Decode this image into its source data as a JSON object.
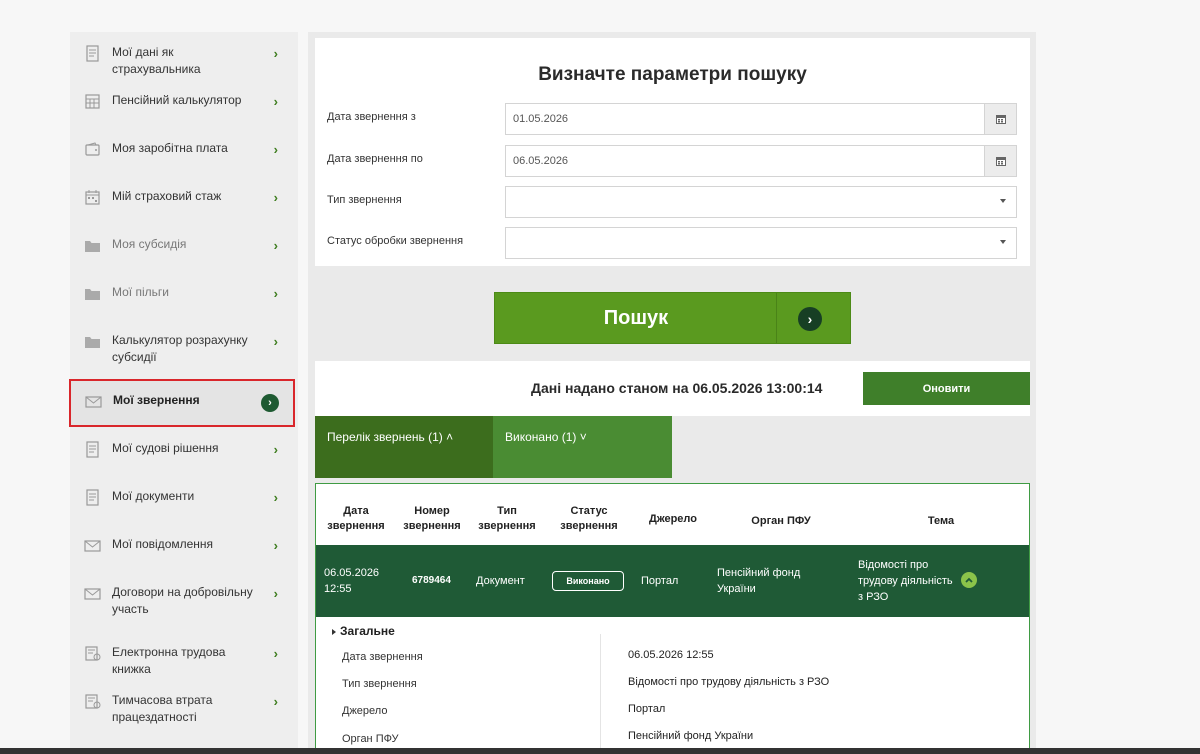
{
  "sidebar": {
    "items": [
      {
        "label": "Мої дані як страхувальника",
        "icon": "document-icon",
        "muted": false
      },
      {
        "label": "Пенсійний калькулятор",
        "icon": "calculator-icon",
        "muted": false
      },
      {
        "label": "Моя заробітна плата",
        "icon": "wallet-icon",
        "muted": false
      },
      {
        "label": "Мій страховий стаж",
        "icon": "calendar-icon",
        "muted": false
      },
      {
        "label": "Моя субсидія",
        "icon": "folder-icon",
        "muted": true
      },
      {
        "label": "Мої пільги",
        "icon": "folder-icon",
        "muted": true
      },
      {
        "label": "Калькулятор розрахунку субсидії",
        "icon": "folder-icon",
        "muted": false
      },
      {
        "label": "Мої звернення",
        "icon": "envelope-icon",
        "muted": false,
        "active": true
      },
      {
        "label": "Мої судові рішення",
        "icon": "document-icon",
        "muted": false
      },
      {
        "label": "Мої документи",
        "icon": "document-icon",
        "muted": false
      },
      {
        "label": "Мої повідомлення",
        "icon": "envelope-icon",
        "muted": false
      },
      {
        "label": "Договори на добровільну участь",
        "icon": "envelope-icon",
        "muted": false
      },
      {
        "label": "Електронна трудова книжка",
        "icon": "workbook-icon",
        "muted": false
      },
      {
        "label": "Тимчасова втрата працездатності",
        "icon": "workbook-icon",
        "muted": false
      }
    ],
    "chevron": "›"
  },
  "search": {
    "title": "Визначте параметри пошуку",
    "date_from_label": "Дата звернення з",
    "date_from_value": "01.05.2026",
    "date_to_label": "Дата звернення по",
    "date_to_value": "06.05.2026",
    "type_label": "Тип звернення",
    "type_value": "",
    "status_label": "Статус обробки звернення",
    "status_value": "",
    "button_label": "Пошук"
  },
  "status": {
    "text": "Дані надано станом на 06.05.2026 13:00:14",
    "refresh_label": "Оновити"
  },
  "tabs": [
    {
      "label": "Перелік звернень (1) ˄"
    },
    {
      "label": "Виконано (1) ˅"
    }
  ],
  "table": {
    "headers": [
      "Дата звернення",
      "Номер звернення",
      "Тип звернення",
      "Статус звернення",
      "Джерело",
      "Орган ПФУ",
      "Тема"
    ],
    "row": {
      "date": "06.05.2026 12:55",
      "number": "6789464",
      "type": "Документ",
      "status": "Виконано",
      "source": "Портал",
      "organ": "Пенсійний фонд України",
      "topic": "Відомості про трудову діяльність з РЗО"
    }
  },
  "details": {
    "section_title": "Загальне",
    "rows": [
      {
        "label": "Дата звернення",
        "value": "06.05.2026 12:55"
      },
      {
        "label": "Тип звернення",
        "value": "Відомості про трудову діяльність з РЗО"
      },
      {
        "label": "Джерело",
        "value": "Портал"
      },
      {
        "label": "Орган ПФУ",
        "value": "Пенсійний фонд України"
      }
    ]
  },
  "colors": {
    "accent_green": "#5a9a1f",
    "dark_green": "#1f5a36",
    "highlight_red": "#d9262b"
  }
}
